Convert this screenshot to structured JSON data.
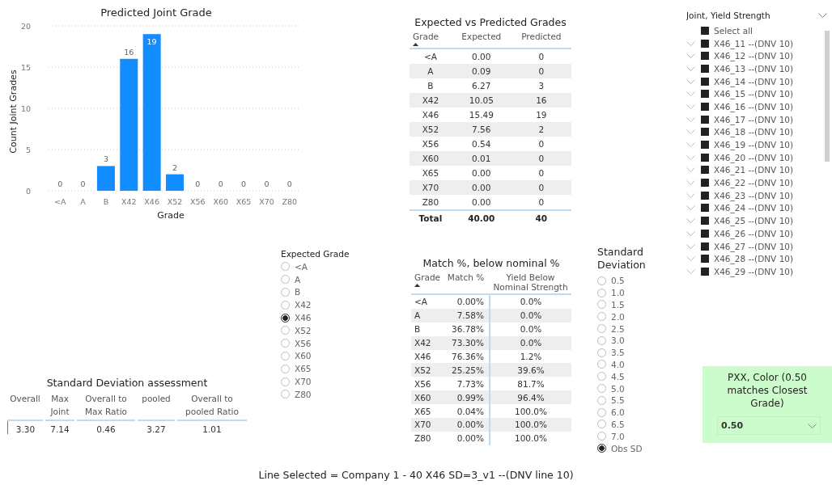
{
  "predicted_chart": {
    "chart_data": {
      "type": "bar",
      "title": "Predicted Joint Grade",
      "xlabel": "Grade",
      "ylabel": "Count Joint Grades",
      "categories": [
        "<A",
        "A",
        "B",
        "X42",
        "X46",
        "X52",
        "X56",
        "X60",
        "X65",
        "X70",
        "Z80"
      ],
      "series": [
        {
          "color": "#118dff",
          "values": [
            0,
            0,
            3,
            16,
            19,
            2,
            0,
            0,
            0,
            0,
            0
          ]
        }
      ],
      "ylim": [
        0,
        20
      ],
      "yticks": [
        0,
        5,
        10,
        15,
        20
      ],
      "data_labels": true,
      "grid": true
    }
  },
  "expected_vs_predicted": {
    "title": "Expected vs Predicted Grades",
    "columns": [
      "Grade",
      "Expected",
      "Predicted"
    ],
    "rows": [
      [
        "<A",
        "0.00",
        "0"
      ],
      [
        "A",
        "0.09",
        "0"
      ],
      [
        "B",
        "6.27",
        "3"
      ],
      [
        "X42",
        "10.05",
        "16"
      ],
      [
        "X46",
        "15.49",
        "19"
      ],
      [
        "X52",
        "7.56",
        "2"
      ],
      [
        "X56",
        "0.54",
        "0"
      ],
      [
        "X60",
        "0.01",
        "0"
      ],
      [
        "X65",
        "0.00",
        "0"
      ],
      [
        "X70",
        "0.00",
        "0"
      ],
      [
        "Z80",
        "0.00",
        "0"
      ]
    ],
    "total": [
      "Total",
      "40.00",
      "40"
    ]
  },
  "joint_slicer": {
    "title": "Joint, Yield Strength",
    "items": [
      {
        "label": "Select all",
        "checked": true
      },
      {
        "label": "X46_11 --(DNV 10)",
        "checked": true
      },
      {
        "label": "X46_12 --(DNV 10)",
        "checked": true
      },
      {
        "label": "X46_13 --(DNV 10)",
        "checked": true
      },
      {
        "label": "X46_14 --(DNV 10)",
        "checked": true
      },
      {
        "label": "X46_15 --(DNV 10)",
        "checked": true
      },
      {
        "label": "X46_16 --(DNV 10)",
        "checked": true
      },
      {
        "label": "X46_17 --(DNV 10)",
        "checked": true
      },
      {
        "label": "X46_18 --(DNV 10)",
        "checked": true
      },
      {
        "label": "X46_19 --(DNV 10)",
        "checked": true
      },
      {
        "label": "X46_20 --(DNV 10)",
        "checked": true
      },
      {
        "label": "X46_21 --(DNV 10)",
        "checked": true
      },
      {
        "label": "X46_22 --(DNV 10)",
        "checked": true
      },
      {
        "label": "X46_23 --(DNV 10)",
        "checked": true
      },
      {
        "label": "X46_24 --(DNV 10)",
        "checked": true
      },
      {
        "label": "X46_25 --(DNV 10)",
        "checked": true
      },
      {
        "label": "X46_26 --(DNV 10)",
        "checked": true
      },
      {
        "label": "X46_27 --(DNV 10)",
        "checked": true
      },
      {
        "label": "X46_28 --(DNV 10)",
        "checked": true
      },
      {
        "label": "X46_29 --(DNV 10)",
        "checked": true
      }
    ]
  },
  "expected_grade": {
    "title": "Expected Grade",
    "items": [
      {
        "label": "<A",
        "selected": false
      },
      {
        "label": "A",
        "selected": false
      },
      {
        "label": "B",
        "selected": false
      },
      {
        "label": "X42",
        "selected": false
      },
      {
        "label": "X46",
        "selected": true
      },
      {
        "label": "X52",
        "selected": false
      },
      {
        "label": "X56",
        "selected": false
      },
      {
        "label": "X60",
        "selected": false
      },
      {
        "label": "X65",
        "selected": false
      },
      {
        "label": "X70",
        "selected": false
      },
      {
        "label": "Z80",
        "selected": false
      }
    ]
  },
  "match_table": {
    "title": "Match %, below nominal %",
    "columns": [
      "Grade",
      "Match %",
      "Yield Below Nominal Strength"
    ],
    "rows": [
      [
        "<A",
        "0.00%",
        "0.0%"
      ],
      [
        "A",
        "7.58%",
        "0.0%"
      ],
      [
        "B",
        "36.78%",
        "0.0%"
      ],
      [
        "X42",
        "73.30%",
        "0.0%"
      ],
      [
        "X46",
        "76.36%",
        "1.2%"
      ],
      [
        "X52",
        "25.25%",
        "39.6%"
      ],
      [
        "X56",
        "7.73%",
        "81.7%"
      ],
      [
        "X60",
        "0.99%",
        "96.4%"
      ],
      [
        "X65",
        "0.04%",
        "100.0%"
      ],
      [
        "X70",
        "0.00%",
        "100.0%"
      ],
      [
        "Z80",
        "0.00%",
        "100.0%"
      ]
    ]
  },
  "standard_deviation": {
    "title": "Standard Deviation",
    "items": [
      {
        "label": "0.5",
        "selected": false
      },
      {
        "label": "1.0",
        "selected": false
      },
      {
        "label": "1.5",
        "selected": false
      },
      {
        "label": "2.0",
        "selected": false
      },
      {
        "label": "2.5",
        "selected": false
      },
      {
        "label": "3.0",
        "selected": false
      },
      {
        "label": "3.5",
        "selected": false
      },
      {
        "label": "4.0",
        "selected": false
      },
      {
        "label": "4.5",
        "selected": false
      },
      {
        "label": "5.0",
        "selected": false
      },
      {
        "label": "5.5",
        "selected": false
      },
      {
        "label": "6.0",
        "selected": false
      },
      {
        "label": "6.5",
        "selected": false
      },
      {
        "label": "7.0",
        "selected": false
      },
      {
        "label": "Obs SD",
        "selected": true
      }
    ]
  },
  "pxx_color": {
    "title": "PXX, Color (0.50 matches Closest Grade)",
    "value": "0.50"
  },
  "sd_assessment": {
    "title": "Standard Deviation assessment",
    "columns": [
      "Overall",
      "Max Joint",
      "Overall to Max Ratio",
      "pooled",
      "Overall to pooled Ratio"
    ],
    "values": [
      "3.30",
      "7.14",
      "0.46",
      "3.27",
      "1.01"
    ]
  },
  "footer": "Line Selected = Company 1 - 40 X46 SD=3_v1 --(DNV line 10)"
}
